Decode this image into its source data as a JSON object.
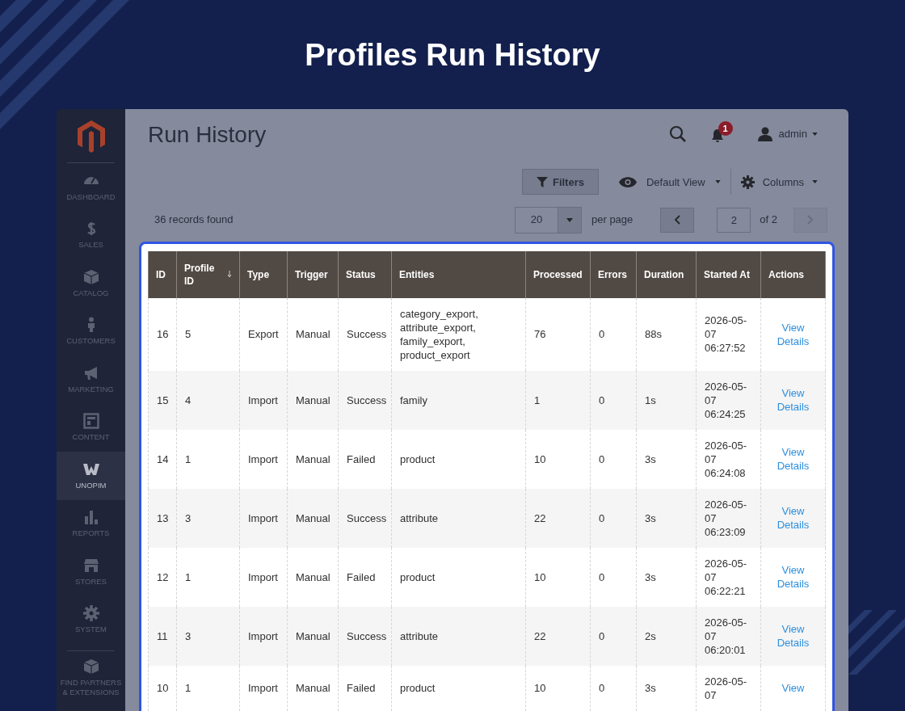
{
  "banner_title": "Profiles Run History",
  "sidebar": {
    "items": [
      {
        "kind": "dashboard",
        "label": "DASHBOARD",
        "selected": false
      },
      {
        "kind": "sales",
        "label": "SALES",
        "selected": false
      },
      {
        "kind": "catalog",
        "label": "CATALOG",
        "selected": false
      },
      {
        "kind": "customers",
        "label": "CUSTOMERS",
        "selected": false
      },
      {
        "kind": "marketing",
        "label": "MARKETING",
        "selected": false
      },
      {
        "kind": "content",
        "label": "CONTENT",
        "selected": false
      },
      {
        "kind": "unopim",
        "label": "UNOPIM",
        "selected": true
      },
      {
        "kind": "reports",
        "label": "REPORTS",
        "selected": false
      },
      {
        "kind": "stores",
        "label": "STORES",
        "selected": false
      },
      {
        "kind": "system",
        "label": "SYSTEM",
        "selected": false
      },
      {
        "kind": "partners",
        "label": "FIND PARTNERS & EXTENSIONS",
        "selected": false
      }
    ]
  },
  "header": {
    "page_title": "Run History",
    "notification_count": "1",
    "user": "admin"
  },
  "toolbar": {
    "filters": "Filters",
    "view": "Default View",
    "columns": "Columns"
  },
  "pager": {
    "records": "36 records found",
    "per_page": "20",
    "per_page_label": "per page",
    "page": "2",
    "page_total": "of 2"
  },
  "table": {
    "columns": [
      {
        "label": "ID",
        "sorted": false
      },
      {
        "label": "Profile ID",
        "sorted": true
      },
      {
        "label": "Type",
        "sorted": false
      },
      {
        "label": "Trigger",
        "sorted": false
      },
      {
        "label": "Status",
        "sorted": false
      },
      {
        "label": "Entities",
        "sorted": false
      },
      {
        "label": "Processed",
        "sorted": false
      },
      {
        "label": "Errors",
        "sorted": false
      },
      {
        "label": "Duration",
        "sorted": false
      },
      {
        "label": "Started At",
        "sorted": false
      },
      {
        "label": "Actions",
        "sorted": false
      }
    ],
    "rows": [
      {
        "cells": [
          "16",
          "5",
          "Export",
          "Manual",
          "Success",
          "category_export, attribute_export, family_export, product_export",
          "76",
          "0",
          "88s",
          "2026-05-07 06:27:52"
        ],
        "action": "View Details"
      },
      {
        "cells": [
          "15",
          "4",
          "Import",
          "Manual",
          "Success",
          "family",
          "1",
          "0",
          "1s",
          "2026-05-07 06:24:25"
        ],
        "action": "View Details"
      },
      {
        "cells": [
          "14",
          "1",
          "Import",
          "Manual",
          "Failed",
          "product",
          "10",
          "0",
          "3s",
          "2026-05-07 06:24:08"
        ],
        "action": "View Details"
      },
      {
        "cells": [
          "13",
          "3",
          "Import",
          "Manual",
          "Success",
          "attribute",
          "22",
          "0",
          "3s",
          "2026-05-07 06:23:09"
        ],
        "action": "View Details"
      },
      {
        "cells": [
          "12",
          "1",
          "Import",
          "Manual",
          "Failed",
          "product",
          "10",
          "0",
          "3s",
          "2026-05-07 06:22:21"
        ],
        "action": "View Details"
      },
      {
        "cells": [
          "11",
          "3",
          "Import",
          "Manual",
          "Success",
          "attribute",
          "22",
          "0",
          "2s",
          "2026-05-07 06:20:01"
        ],
        "action": "View Details"
      },
      {
        "cells": [
          "10",
          "1",
          "Import",
          "Manual",
          "Failed",
          "product",
          "10",
          "0",
          "3s",
          "2026-05-07"
        ],
        "action": "View"
      }
    ]
  }
}
